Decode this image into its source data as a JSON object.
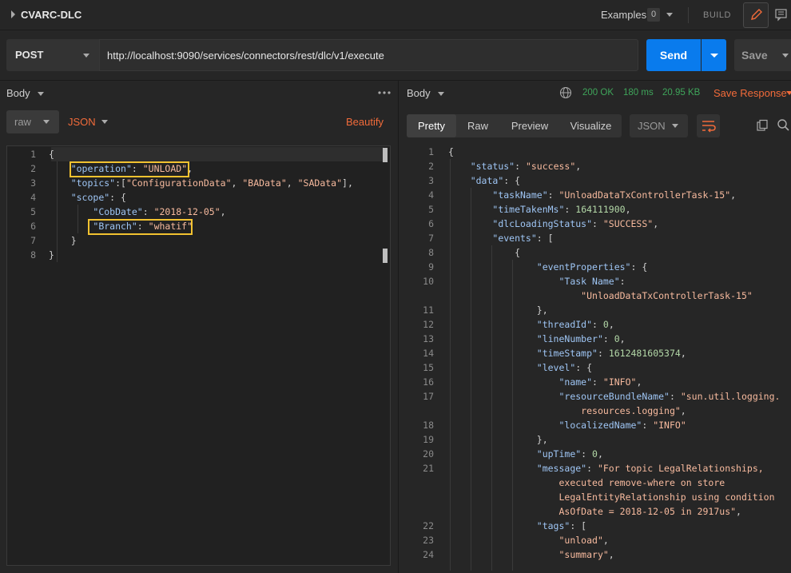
{
  "title": "CVARC-DLC",
  "header": {
    "examples_label": "Examples",
    "examples_count": "0",
    "build_label": "BUILD"
  },
  "request": {
    "method": "POST",
    "url": "http://localhost:9090/services/connectors/rest/dlc/v1/execute",
    "send_label": "Send",
    "save_label": "Save"
  },
  "request_body": {
    "tab_label": "Body",
    "mode": "raw",
    "format": "JSON",
    "beautify_label": "Beautify",
    "lines": [
      {
        "n": "1",
        "parts": [
          [
            "p",
            "{"
          ]
        ]
      },
      {
        "n": "2",
        "parts": [
          [
            "p",
            "    "
          ],
          [
            "k",
            "\"operation\""
          ],
          [
            "p",
            ": "
          ],
          [
            "s",
            "\"UNLOAD\""
          ],
          [
            "p",
            ","
          ]
        ]
      },
      {
        "n": "3",
        "parts": [
          [
            "p",
            "    "
          ],
          [
            "k",
            "\"topics\""
          ],
          [
            "p",
            ":["
          ],
          [
            "s",
            "\"ConfigurationData\""
          ],
          [
            "p",
            ", "
          ],
          [
            "s",
            "\"BAData\""
          ],
          [
            "p",
            ", "
          ],
          [
            "s",
            "\"SAData\""
          ],
          [
            "p",
            "],"
          ]
        ]
      },
      {
        "n": "4",
        "parts": [
          [
            "p",
            "    "
          ],
          [
            "k",
            "\"scope\""
          ],
          [
            "p",
            ": {"
          ]
        ]
      },
      {
        "n": "5",
        "parts": [
          [
            "p",
            "        "
          ],
          [
            "k",
            "\"CobDate\""
          ],
          [
            "p",
            ": "
          ],
          [
            "s",
            "\"2018-12-05\""
          ],
          [
            "p",
            ","
          ]
        ]
      },
      {
        "n": "6",
        "parts": [
          [
            "p",
            "        "
          ],
          [
            "k",
            "\"Branch\""
          ],
          [
            "p",
            ": "
          ],
          [
            "s",
            "\"whatif\""
          ]
        ]
      },
      {
        "n": "7",
        "parts": [
          [
            "p",
            "    }"
          ]
        ]
      },
      {
        "n": "8",
        "parts": [
          [
            "p",
            "}"
          ]
        ]
      }
    ]
  },
  "response": {
    "tab_label": "Body",
    "status": "200 OK",
    "time": "180 ms",
    "size": "20.95 KB",
    "save_response_label": "Save Response",
    "view_tabs": [
      "Pretty",
      "Raw",
      "Preview",
      "Visualize"
    ],
    "format": "JSON",
    "lines": [
      {
        "n": "1",
        "parts": [
          [
            "p",
            "{"
          ]
        ]
      },
      {
        "n": "2",
        "parts": [
          [
            "p",
            "    "
          ],
          [
            "k",
            "\"status\""
          ],
          [
            "p",
            ": "
          ],
          [
            "s",
            "\"success\""
          ],
          [
            "p",
            ","
          ]
        ]
      },
      {
        "n": "3",
        "parts": [
          [
            "p",
            "    "
          ],
          [
            "k",
            "\"data\""
          ],
          [
            "p",
            ": {"
          ]
        ]
      },
      {
        "n": "4",
        "parts": [
          [
            "p",
            "        "
          ],
          [
            "k",
            "\"taskName\""
          ],
          [
            "p",
            ": "
          ],
          [
            "s",
            "\"UnloadDataTxControllerTask-15\""
          ],
          [
            "p",
            ","
          ]
        ]
      },
      {
        "n": "5",
        "parts": [
          [
            "p",
            "        "
          ],
          [
            "k",
            "\"timeTakenMs\""
          ],
          [
            "p",
            ": "
          ],
          [
            "n",
            "164111900"
          ],
          [
            "p",
            ","
          ]
        ]
      },
      {
        "n": "6",
        "parts": [
          [
            "p",
            "        "
          ],
          [
            "k",
            "\"dlcLoadingStatus\""
          ],
          [
            "p",
            ": "
          ],
          [
            "s",
            "\"SUCCESS\""
          ],
          [
            "p",
            ","
          ]
        ]
      },
      {
        "n": "7",
        "parts": [
          [
            "p",
            "        "
          ],
          [
            "k",
            "\"events\""
          ],
          [
            "p",
            ": ["
          ]
        ]
      },
      {
        "n": "8",
        "parts": [
          [
            "p",
            "            {"
          ]
        ]
      },
      {
        "n": "9",
        "parts": [
          [
            "p",
            "                "
          ],
          [
            "k",
            "\"eventProperties\""
          ],
          [
            "p",
            ": {"
          ]
        ]
      },
      {
        "n": "10",
        "parts": [
          [
            "p",
            "                    "
          ],
          [
            "k",
            "\"Task Name\""
          ],
          [
            "p",
            ":"
          ]
        ]
      },
      {
        "n": "",
        "parts": [
          [
            "p",
            "                        "
          ],
          [
            "s",
            "\"UnloadDataTxControllerTask-15\""
          ]
        ]
      },
      {
        "n": "11",
        "parts": [
          [
            "p",
            "                },"
          ]
        ]
      },
      {
        "n": "12",
        "parts": [
          [
            "p",
            "                "
          ],
          [
            "k",
            "\"threadId\""
          ],
          [
            "p",
            ": "
          ],
          [
            "n",
            "0"
          ],
          [
            "p",
            ","
          ]
        ]
      },
      {
        "n": "13",
        "parts": [
          [
            "p",
            "                "
          ],
          [
            "k",
            "\"lineNumber\""
          ],
          [
            "p",
            ": "
          ],
          [
            "n",
            "0"
          ],
          [
            "p",
            ","
          ]
        ]
      },
      {
        "n": "14",
        "parts": [
          [
            "p",
            "                "
          ],
          [
            "k",
            "\"timeStamp\""
          ],
          [
            "p",
            ": "
          ],
          [
            "n",
            "1612481605374"
          ],
          [
            "p",
            ","
          ]
        ]
      },
      {
        "n": "15",
        "parts": [
          [
            "p",
            "                "
          ],
          [
            "k",
            "\"level\""
          ],
          [
            "p",
            ": {"
          ]
        ]
      },
      {
        "n": "16",
        "parts": [
          [
            "p",
            "                    "
          ],
          [
            "k",
            "\"name\""
          ],
          [
            "p",
            ": "
          ],
          [
            "s",
            "\"INFO\""
          ],
          [
            "p",
            ","
          ]
        ]
      },
      {
        "n": "17",
        "parts": [
          [
            "p",
            "                    "
          ],
          [
            "k",
            "\"resourceBundleName\""
          ],
          [
            "p",
            ": "
          ],
          [
            "s",
            "\"sun.util.logging."
          ]
        ]
      },
      {
        "n": "",
        "parts": [
          [
            "p",
            "                        "
          ],
          [
            "s",
            "resources.logging\""
          ],
          [
            "p",
            ","
          ]
        ]
      },
      {
        "n": "18",
        "parts": [
          [
            "p",
            "                    "
          ],
          [
            "k",
            "\"localizedName\""
          ],
          [
            "p",
            ": "
          ],
          [
            "s",
            "\"INFO\""
          ]
        ]
      },
      {
        "n": "19",
        "parts": [
          [
            "p",
            "                },"
          ]
        ]
      },
      {
        "n": "20",
        "parts": [
          [
            "p",
            "                "
          ],
          [
            "k",
            "\"upTime\""
          ],
          [
            "p",
            ": "
          ],
          [
            "n",
            "0"
          ],
          [
            "p",
            ","
          ]
        ]
      },
      {
        "n": "21",
        "parts": [
          [
            "p",
            "                "
          ],
          [
            "k",
            "\"message\""
          ],
          [
            "p",
            ": "
          ],
          [
            "s",
            "\"For topic LegalRelationships,"
          ]
        ]
      },
      {
        "n": "",
        "parts": [
          [
            "p",
            "                    "
          ],
          [
            "s",
            "executed remove-where on store"
          ]
        ]
      },
      {
        "n": "",
        "parts": [
          [
            "p",
            "                    "
          ],
          [
            "s",
            "LegalEntityRelationship using condition"
          ]
        ]
      },
      {
        "n": "",
        "parts": [
          [
            "p",
            "                    "
          ],
          [
            "s",
            "AsOfDate = 2018-12-05 in 2917us\""
          ],
          [
            "p",
            ","
          ]
        ]
      },
      {
        "n": "22",
        "parts": [
          [
            "p",
            "                "
          ],
          [
            "k",
            "\"tags\""
          ],
          [
            "p",
            ": ["
          ]
        ]
      },
      {
        "n": "23",
        "parts": [
          [
            "p",
            "                    "
          ],
          [
            "s",
            "\"unload\""
          ],
          [
            "p",
            ","
          ]
        ]
      },
      {
        "n": "24",
        "parts": [
          [
            "p",
            "                    "
          ],
          [
            "s",
            "\"summary\""
          ],
          [
            "p",
            ","
          ]
        ]
      }
    ]
  },
  "colors": {
    "accent": "#f26b3a",
    "send": "#097bed",
    "ok": "#3fa55a",
    "highlight_box": "#f2c230"
  },
  "icons": [
    "edit-icon",
    "comment-icon",
    "more-icon",
    "globe-icon",
    "wrap-icon",
    "copy-icon",
    "search-icon"
  ]
}
